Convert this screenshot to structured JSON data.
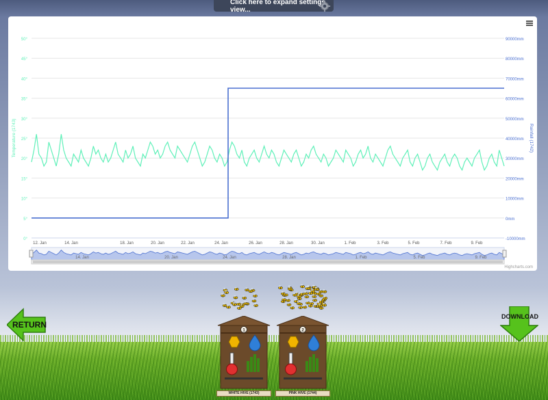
{
  "settings": {
    "label": "Click here to expand settings view..."
  },
  "chart_data": {
    "type": "line",
    "title": "",
    "y_axes": [
      {
        "label": "Temperature (1743)",
        "side": "left",
        "ticks": [
          "0°",
          "5°",
          "10°",
          "15°",
          "20°",
          "25°",
          "30°",
          "35°",
          "40°",
          "45°",
          "50°"
        ],
        "range": [
          0,
          50
        ],
        "color": "#5ef0b8"
      },
      {
        "label": "Rainfall (1742)",
        "side": "right",
        "ticks": [
          "-10000mm",
          "0mm",
          "10000mm",
          "20000mm",
          "30000mm",
          "40000mm",
          "50000mm",
          "60000mm",
          "70000mm",
          "80000mm",
          "90000mm"
        ],
        "range": [
          -10000,
          90000
        ],
        "color": "#4a6fd0"
      }
    ],
    "x_ticks": [
      "12. Jan",
      "14. Jan",
      "18. Jan",
      "20. Jan",
      "22. Jan",
      "24. Jan",
      "26. Jan",
      "28. Jan",
      "30. Jan",
      "1. Feb",
      "3. Feb",
      "5. Feb",
      "7. Feb",
      "9. Feb"
    ],
    "navigator_ticks": [
      "14. Jan",
      "20. Jan",
      "24. Jan",
      "28. Jan",
      "1. Feb",
      "5. Feb",
      "9. Feb"
    ],
    "series": [
      {
        "name": "Temperature (1743)",
        "color": "#5ef0b8",
        "values": [
          19,
          22,
          26,
          21,
          20,
          18,
          19,
          24,
          22,
          20,
          18,
          21,
          26,
          22,
          20,
          19,
          18,
          21,
          20,
          19,
          22,
          20,
          19,
          18,
          20,
          23,
          21,
          22,
          20,
          19,
          21,
          19,
          20,
          22,
          24,
          21,
          20,
          19,
          22,
          20,
          21,
          23,
          20,
          19,
          18,
          21,
          20,
          22,
          24,
          23,
          21,
          22,
          20,
          21,
          23,
          24,
          22,
          21,
          20,
          23,
          22,
          21,
          20,
          19,
          21,
          23,
          24,
          22,
          20,
          18,
          19,
          21,
          23,
          22,
          20,
          19,
          21,
          20,
          18,
          19,
          22,
          24,
          23,
          21,
          20,
          22,
          19,
          18,
          20,
          21,
          22,
          20,
          19,
          21,
          23,
          21,
          20,
          22,
          21,
          19,
          18,
          20,
          22,
          21,
          20,
          19,
          21,
          22,
          20,
          18,
          19,
          21,
          20,
          22,
          23,
          21,
          20,
          19,
          21,
          20,
          18,
          19,
          20,
          22,
          21,
          20,
          19,
          22,
          21,
          20,
          18,
          19,
          21,
          22,
          20,
          21,
          23,
          20,
          19,
          21,
          20,
          19,
          18,
          20,
          22,
          23,
          21,
          20,
          19,
          18,
          20,
          21,
          22,
          19,
          18,
          20,
          21,
          19,
          17,
          18,
          20,
          21,
          19,
          18,
          17,
          19,
          20,
          21,
          19,
          18,
          20,
          21,
          20,
          18,
          17,
          19,
          20,
          19,
          18,
          20,
          21,
          22,
          19,
          17,
          18,
          20,
          21,
          19,
          18,
          22,
          20,
          18
        ]
      },
      {
        "name": "Rainfall (1742)",
        "color": "#4a6fd0",
        "steps": [
          {
            "from": 0.0,
            "to": 0.416,
            "value": 0
          },
          {
            "from": 0.416,
            "to": 1.0,
            "value": 65000
          }
        ]
      }
    ],
    "grid": true
  },
  "credits": "Highcharts.com",
  "nav": {
    "return_label": "RETURN",
    "download_label": "DOWNLOAD"
  },
  "hives": [
    {
      "number": "1",
      "label": "WHITE HIVE (1743)"
    },
    {
      "number": "2",
      "label": "PINK HIVE (1744)"
    }
  ],
  "colors": {
    "honeycomb": "#f0b400",
    "water": "#2f7fd8",
    "thermometer": "#e03030",
    "wood": "#6b4a2a",
    "accent_green": "#56c21c"
  }
}
